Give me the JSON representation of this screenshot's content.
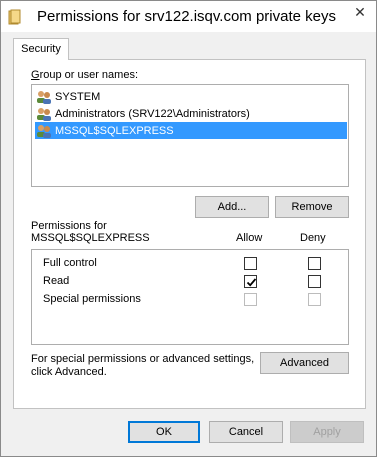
{
  "window": {
    "title": "Permissions for srv122.isqv.com private keys",
    "close_label": "✕"
  },
  "tabs": [
    {
      "label": "Security",
      "selected": true
    }
  ],
  "security": {
    "group_label": "Group or user names:",
    "users": [
      {
        "name": "SYSTEM",
        "selected": false
      },
      {
        "name": "Administrators (SRV122\\Administrators)",
        "selected": false
      },
      {
        "name": "MSSQL$SQLEXPRESS",
        "selected": true
      }
    ],
    "add_label": "Add...",
    "remove_label": "Remove",
    "permissions_for_label": "Permissions for",
    "permissions_for_user": "MSSQL$SQLEXPRESS",
    "allow_header": "Allow",
    "deny_header": "Deny",
    "permissions": [
      {
        "name": "Full control",
        "allow": false,
        "deny": false,
        "enabled": true
      },
      {
        "name": "Read",
        "allow": true,
        "deny": false,
        "enabled": true
      },
      {
        "name": "Special permissions",
        "allow": false,
        "deny": false,
        "enabled": false
      }
    ],
    "advanced_note_line1": "For special permissions or advanced settings,",
    "advanced_note_line2": "click Advanced.",
    "advanced_label": "Advanced"
  },
  "footer": {
    "ok_label": "OK",
    "cancel_label": "Cancel",
    "apply_label": "Apply"
  },
  "colors": {
    "selection": "#3399ff",
    "default_button_border": "#0078d7",
    "window_background": "#f0f0f0"
  }
}
